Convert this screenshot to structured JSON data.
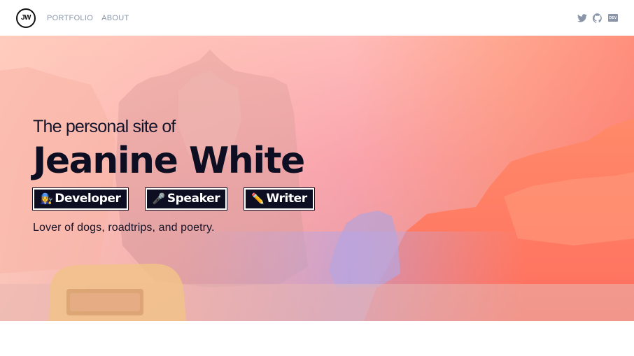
{
  "nav": {
    "logo_text": "JW",
    "links": [
      {
        "label": "PORTFOLIO"
      },
      {
        "label": "ABOUT"
      }
    ],
    "icons": [
      "twitter-icon",
      "github-icon",
      "dev-icon"
    ],
    "dev_label": "DEV"
  },
  "hero": {
    "subtitle": "The personal site of",
    "name": "Jeanine White",
    "tags": [
      {
        "emoji": "👩‍🔧",
        "label": "Developer"
      },
      {
        "emoji": "🎤",
        "label": "Speaker"
      },
      {
        "emoji": "✏️",
        "label": "Writer"
      }
    ],
    "tagline": "Lover of dogs, roadtrips, and poetry."
  },
  "colors": {
    "nav_text": "#8a96a8",
    "heading": "#0e0e22",
    "hero_peach": "#ffc6b8",
    "hero_coral": "#ff7a66",
    "hero_lavender": "#b9a8e0"
  }
}
